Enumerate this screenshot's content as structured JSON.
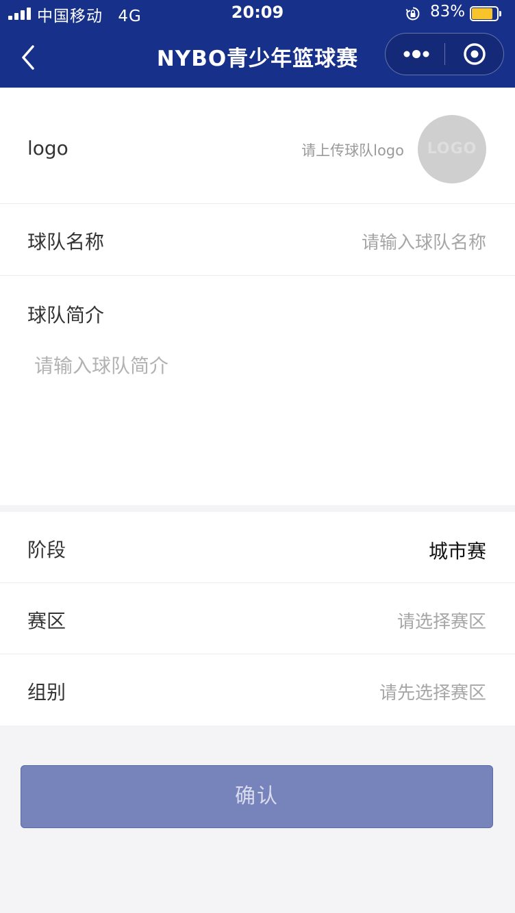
{
  "status_bar": {
    "carrier": "中国移动",
    "network": "4G",
    "time": "20:09",
    "battery_percent_text": "83%",
    "battery_level": 0.83
  },
  "navbar": {
    "title": "NYBO青少年篮球赛",
    "back_icon": "chevron-left-icon",
    "more_icon": "more-dots-icon",
    "close_icon": "target-circle-icon"
  },
  "form": {
    "logo": {
      "label": "logo",
      "hint": "请上传球队logo",
      "placeholder_text": "LOGO"
    },
    "team_name": {
      "label": "球队名称",
      "placeholder": "请输入球队名称"
    },
    "team_intro": {
      "label": "球队简介",
      "placeholder": "请输入球队简介"
    },
    "stage": {
      "label": "阶段",
      "value": "城市赛"
    },
    "zone": {
      "label": "赛区",
      "placeholder": "请选择赛区"
    },
    "group": {
      "label": "组别",
      "placeholder": "请先选择赛区"
    }
  },
  "confirm_label": "确认",
  "colors": {
    "header": "#17308a",
    "button": "#7684bb",
    "battery": "#f7c52b"
  }
}
